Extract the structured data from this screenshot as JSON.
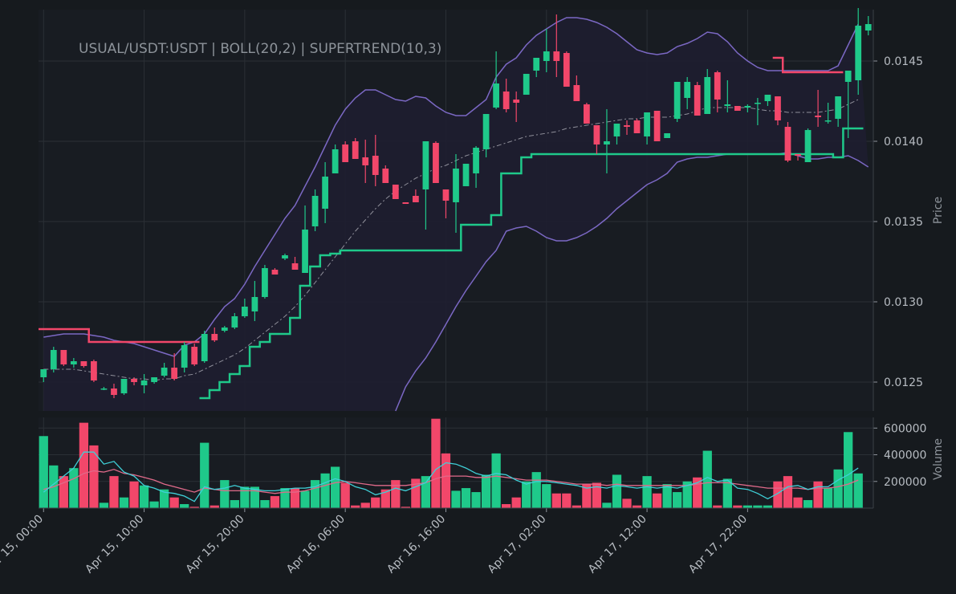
{
  "chart_data": {
    "type": "candlestick",
    "title": "USUAL/USDT:USDT | BOLL(20,2) | SUPERTREND(10,3)",
    "ylabel": "Price",
    "volume_label": "Volume",
    "ylim": [
      0.01232,
      0.01482
    ],
    "y_ticks": [
      0.0125,
      0.013,
      0.0135,
      0.014,
      0.0145
    ],
    "y_tick_labels": [
      "0.0125",
      "0.0130",
      "0.0135",
      "0.0140",
      "0.0145"
    ],
    "volume_ylim": [
      0,
      680000
    ],
    "volume_ticks": [
      200000,
      400000,
      600000
    ],
    "volume_tick_labels": [
      "200000",
      "400000",
      "600000"
    ],
    "x_start": "2025-04-15 00:00",
    "bar_interval_hours": 1,
    "x_tick_labels": [
      "Apr 15, 00:00",
      "Apr 15, 10:00",
      "Apr 15, 20:00",
      "Apr 16, 06:00",
      "Apr 16, 16:00",
      "Apr 17, 02:00",
      "Apr 17, 12:00",
      "Apr 17, 22:00"
    ],
    "x_tick_index": [
      0,
      10,
      20,
      30,
      40,
      50,
      60,
      70
    ],
    "colors": {
      "background": "#161a1e",
      "grid": "#2b3036",
      "up": "#1fc98a",
      "down": "#f2476a",
      "band": "#7b68c4",
      "band_fill": "#1e1e30",
      "mid": "#8f8f9a",
      "vol_ma_fast": "#3fd0d8",
      "vol_ma_slow": "#e06a8a"
    },
    "candles": [
      [
        0.01253,
        0.01258,
        0.0125,
        0.01258
      ],
      [
        0.01258,
        0.01272,
        0.01256,
        0.0127
      ],
      [
        0.0127,
        0.0127,
        0.0126,
        0.01261
      ],
      [
        0.01261,
        0.01265,
        0.01259,
        0.01263
      ],
      [
        0.01263,
        0.01263,
        0.01259,
        0.0126
      ],
      [
        0.01263,
        0.01264,
        0.0125,
        0.01251
      ],
      [
        0.01246,
        0.01247,
        0.01245,
        0.01246
      ],
      [
        0.01246,
        0.01249,
        0.0124,
        0.01242
      ],
      [
        0.01243,
        0.01252,
        0.01242,
        0.01252
      ],
      [
        0.01252,
        0.01253,
        0.01248,
        0.0125
      ],
      [
        0.01248,
        0.01255,
        0.01243,
        0.01251
      ],
      [
        0.0125,
        0.01253,
        0.01249,
        0.01253
      ],
      [
        0.01254,
        0.01262,
        0.01253,
        0.01259
      ],
      [
        0.01259,
        0.01268,
        0.01251,
        0.01252
      ],
      [
        0.01259,
        0.01275,
        0.01256,
        0.01273
      ],
      [
        0.01272,
        0.01274,
        0.0126,
        0.01261
      ],
      [
        0.01263,
        0.01282,
        0.01262,
        0.0128
      ],
      [
        0.0128,
        0.01284,
        0.01275,
        0.01276
      ],
      [
        0.01282,
        0.01285,
        0.01281,
        0.01284
      ],
      [
        0.01284,
        0.01293,
        0.01283,
        0.01291
      ],
      [
        0.01291,
        0.01302,
        0.0129,
        0.01297
      ],
      [
        0.01294,
        0.01313,
        0.01288,
        0.01303
      ],
      [
        0.01303,
        0.01323,
        0.01302,
        0.01321
      ],
      [
        0.0132,
        0.01321,
        0.01317,
        0.01317
      ],
      [
        0.01327,
        0.0133,
        0.01326,
        0.01329
      ],
      [
        0.01324,
        0.01328,
        0.01322,
        0.0132
      ],
      [
        0.01318,
        0.0136,
        0.01318,
        0.01345
      ],
      [
        0.01347,
        0.0137,
        0.01344,
        0.01366
      ],
      [
        0.01358,
        0.01387,
        0.01349,
        0.01378
      ],
      [
        0.0138,
        0.01398,
        0.0138,
        0.01395
      ],
      [
        0.01398,
        0.014,
        0.01387,
        0.01387
      ],
      [
        0.014,
        0.01402,
        0.01402,
        0.01389
      ],
      [
        0.0139,
        0.01401,
        0.01374,
        0.01385
      ],
      [
        0.01391,
        0.01404,
        0.01372,
        0.01379
      ],
      [
        0.01383,
        0.01385,
        0.01383,
        0.01374
      ],
      [
        0.01373,
        0.01373,
        0.0138,
        0.01364
      ],
      [
        0.01362,
        0.01348,
        0.01375,
        0.01361
      ],
      [
        0.01366,
        0.0137,
        0.01362,
        0.01362
      ],
      [
        0.0137,
        0.014,
        0.01345,
        0.014
      ],
      [
        0.01399,
        0.014,
        0.01374,
        0.01374
      ],
      [
        0.0137,
        0.0137,
        0.01352,
        0.01363
      ],
      [
        0.01362,
        0.01392,
        0.01343,
        0.01383
      ],
      [
        0.01372,
        0.01386,
        0.01373,
        0.01386
      ],
      [
        0.0138,
        0.01397,
        0.01371,
        0.01396
      ],
      [
        0.01395,
        0.01417,
        0.0139,
        0.01417
      ],
      [
        0.01421,
        0.01456,
        0.0142,
        0.01436
      ],
      [
        0.01431,
        0.01439,
        0.01418,
        0.0142
      ],
      [
        0.01426,
        0.01431,
        0.01412,
        0.01424
      ],
      [
        0.01429,
        0.01442,
        0.01429,
        0.01442
      ],
      [
        0.01444,
        0.01452,
        0.0144,
        0.01452
      ],
      [
        0.0145,
        0.0147,
        0.01443,
        0.01456
      ],
      [
        0.01456,
        0.01479,
        0.0144,
        0.0145
      ],
      [
        0.01455,
        0.01456,
        0.01434,
        0.01434
      ],
      [
        0.01435,
        0.01441,
        0.01425,
        0.01425
      ],
      [
        0.01423,
        0.01424,
        0.01411,
        0.01411
      ],
      [
        0.0141,
        0.01403,
        0.01392,
        0.01398
      ],
      [
        0.01398,
        0.0142,
        0.0138,
        0.014
      ],
      [
        0.01403,
        0.01411,
        0.01398,
        0.01411
      ],
      [
        0.0141,
        0.01413,
        0.01404,
        0.01409
      ],
      [
        0.01413,
        0.01414,
        0.01406,
        0.01405
      ],
      [
        0.01403,
        0.01418,
        0.01398,
        0.01418
      ],
      [
        0.01419,
        0.01419,
        0.014,
        0.014
      ],
      [
        0.01402,
        0.01403,
        0.01402,
        0.01405
      ],
      [
        0.01414,
        0.01435,
        0.01412,
        0.01437
      ],
      [
        0.01427,
        0.0144,
        0.0142,
        0.01437
      ],
      [
        0.01435,
        0.01437,
        0.01416,
        0.01416
      ],
      [
        0.01417,
        0.01445,
        0.01419,
        0.0144
      ],
      [
        0.01443,
        0.01444,
        0.01418,
        0.01426
      ],
      [
        0.01422,
        0.01438,
        0.01418,
        0.01423
      ],
      [
        0.01422,
        0.01421,
        0.0142,
        0.01419
      ],
      [
        0.01421,
        0.01423,
        0.01418,
        0.01422
      ],
      [
        0.01424,
        0.01427,
        0.0141,
        0.01424
      ],
      [
        0.01425,
        0.01425,
        0.01422,
        0.01429
      ],
      [
        0.01428,
        0.01428,
        0.0141,
        0.01413
      ],
      [
        0.01409,
        0.01412,
        0.01387,
        0.01388
      ],
      [
        0.01392,
        0.01392,
        0.01388,
        0.01391
      ],
      [
        0.01387,
        0.01408,
        0.01391,
        0.01407
      ],
      [
        0.01416,
        0.01432,
        0.01409,
        0.01415
      ],
      [
        0.01413,
        0.01424,
        0.01411,
        0.01413
      ],
      [
        0.01414,
        0.01417,
        0.01409,
        0.01428
      ],
      [
        0.01437,
        0.01443,
        0.01402,
        0.01444
      ],
      [
        0.01438,
        0.01483,
        0.01429,
        0.01472
      ],
      [
        0.01469,
        0.01478,
        0.01466,
        0.01473
      ]
    ],
    "volume": [
      540000,
      320000,
      240000,
      300000,
      640000,
      470000,
      40000,
      240000,
      80000,
      200000,
      170000,
      50000,
      140000,
      80000,
      30000,
      10000,
      490000,
      20000,
      210000,
      60000,
      160000,
      160000,
      60000,
      90000,
      150000,
      150000,
      130000,
      210000,
      260000,
      310000,
      190000,
      20000,
      40000,
      80000,
      140000,
      210000,
      10000,
      220000,
      240000,
      670000,
      410000,
      130000,
      150000,
      120000,
      250000,
      410000,
      30000,
      80000,
      200000,
      270000,
      180000,
      110000,
      110000,
      20000,
      180000,
      190000,
      40000,
      250000,
      70000,
      20000,
      240000,
      110000,
      180000,
      120000,
      200000,
      230000,
      430000,
      20000,
      220000,
      20000,
      20000,
      20000,
      20000,
      200000,
      240000,
      80000,
      60000,
      200000,
      150000,
      290000,
      570000,
      260000
    ],
    "bb_upper": [
      0.01278,
      0.01279,
      0.0128,
      0.0128,
      0.0128,
      0.01279,
      0.01278,
      0.01276,
      0.01275,
      0.01274,
      0.01272,
      0.0127,
      0.01268,
      0.01266,
      0.01273,
      0.01275,
      0.0128,
      0.01289,
      0.01297,
      0.01302,
      0.01311,
      0.01322,
      0.01332,
      0.01342,
      0.01352,
      0.0136,
      0.01372,
      0.01384,
      0.01397,
      0.0141,
      0.0142,
      0.01427,
      0.01432,
      0.01432,
      0.01429,
      0.01426,
      0.01425,
      0.01428,
      0.01427,
      0.01422,
      0.01418,
      0.01416,
      0.01416,
      0.01421,
      0.01426,
      0.0144,
      0.01448,
      0.01452,
      0.0146,
      0.01466,
      0.0147,
      0.01474,
      0.01477,
      0.01477,
      0.01476,
      0.01474,
      0.01471,
      0.01467,
      0.01462,
      0.01457,
      0.01455,
      0.01454,
      0.01455,
      0.01459,
      0.01461,
      0.01464,
      0.01468,
      0.01467,
      0.01462,
      0.01455,
      0.0145,
      0.01446,
      0.01444,
      0.01444,
      0.01444,
      0.01444,
      0.01444,
      0.01444,
      0.01444,
      0.01447,
      0.0146,
      0.01473
    ],
    "bb_mid": [
      0.01258,
      0.01258,
      0.01258,
      0.01258,
      0.01257,
      0.01256,
      0.01255,
      0.01254,
      0.01253,
      0.01252,
      0.01252,
      0.01251,
      0.01252,
      0.01252,
      0.01254,
      0.01255,
      0.01258,
      0.01261,
      0.01264,
      0.01267,
      0.01271,
      0.01276,
      0.01281,
      0.01286,
      0.01291,
      0.01297,
      0.01304,
      0.01312,
      0.0132,
      0.01328,
      0.01336,
      0.01344,
      0.01351,
      0.01358,
      0.01364,
      0.01369,
      0.01373,
      0.01377,
      0.0138,
      0.01383,
      0.01385,
      0.01388,
      0.01391,
      0.01393,
      0.01395,
      0.01397,
      0.01399,
      0.01401,
      0.01403,
      0.01404,
      0.01405,
      0.01406,
      0.01408,
      0.01409,
      0.0141,
      0.01411,
      0.01412,
      0.01413,
      0.01414,
      0.01414,
      0.01415,
      0.01415,
      0.01415,
      0.01416,
      0.01417,
      0.01419,
      0.01421,
      0.01421,
      0.01421,
      0.01421,
      0.01421,
      0.0142,
      0.01419,
      0.01419,
      0.01418,
      0.01418,
      0.01418,
      0.01418,
      0.01419,
      0.0142,
      0.01423,
      0.01426
    ],
    "bb_lower": [
      null,
      null,
      null,
      null,
      null,
      null,
      null,
      null,
      null,
      null,
      null,
      null,
      null,
      null,
      null,
      null,
      null,
      null,
      null,
      null,
      null,
      null,
      null,
      null,
      null,
      null,
      null,
      null,
      null,
      null,
      null,
      null,
      null,
      null,
      null,
      0.01232,
      0.01247,
      0.01257,
      0.01265,
      0.01275,
      0.01286,
      0.01297,
      0.01307,
      0.01316,
      0.01325,
      0.01332,
      0.01344,
      0.01346,
      0.01347,
      0.01344,
      0.0134,
      0.01338,
      0.01338,
      0.0134,
      0.01343,
      0.01347,
      0.01352,
      0.01358,
      0.01363,
      0.01368,
      0.01373,
      0.01376,
      0.0138,
      0.01387,
      0.01389,
      0.0139,
      0.0139,
      0.01391,
      0.01392,
      0.01392,
      0.01392,
      0.01392,
      0.01392,
      0.01392,
      0.01393,
      0.01391,
      0.01389,
      0.01389,
      0.0139,
      0.0139,
      0.01391,
      0.01388,
      0.01384
    ],
    "supertrend_up": [
      null,
      null,
      null,
      null,
      null,
      null,
      null,
      null,
      null,
      null,
      null,
      null,
      null,
      null,
      null,
      null,
      0.0124,
      0.01245,
      0.0125,
      0.01255,
      0.0126,
      0.01272,
      0.01275,
      0.0128,
      0.0128,
      0.0129,
      0.0131,
      0.01322,
      0.01329,
      0.0133,
      0.01332,
      0.01332,
      0.01332,
      0.01332,
      0.01332,
      0.01332,
      0.01332,
      0.01332,
      0.01332,
      0.01332,
      0.01332,
      0.01332,
      0.01348,
      0.01348,
      0.01348,
      0.01354,
      0.0138,
      0.0138,
      0.0139,
      0.01392,
      0.01392,
      0.01392,
      0.01392,
      0.01392,
      0.01392,
      0.01392,
      0.01392,
      0.01392,
      0.01392,
      0.01392,
      0.01392,
      0.01392,
      0.01392,
      0.01392,
      0.01392,
      0.01392,
      0.01392,
      0.01392,
      0.01392,
      0.01392,
      0.01392,
      0.01392,
      0.01392,
      0.01392,
      0.01392,
      0.01392,
      0.01392,
      0.01392,
      0.01392,
      0.0139,
      0.01408,
      0.01408
    ],
    "supertrend_down": [
      0.01283,
      0.01283,
      0.01283,
      0.01283,
      0.01283,
      0.01275,
      0.01275,
      0.01275,
      0.01275,
      0.01275,
      0.01275,
      0.01275,
      0.01275,
      0.01275,
      0.01275,
      0.01275,
      null,
      null,
      null,
      null,
      null,
      null,
      null,
      null,
      null,
      null,
      null,
      null,
      null,
      null,
      null,
      null,
      null,
      null,
      null,
      null,
      null,
      null,
      null,
      null,
      null,
      null,
      null,
      null,
      null,
      null,
      null,
      null,
      null,
      null,
      null,
      null,
      null,
      null,
      null,
      null,
      null,
      null,
      null,
      null,
      null,
      null,
      null,
      null,
      null,
      null,
      null,
      null,
      null,
      null,
      null,
      null,
      null,
      0.01452,
      0.01443,
      0.01443,
      0.01443,
      0.01443,
      0.01443,
      0.01443,
      null,
      null
    ],
    "vol_ma_fast": [
      120000,
      180000,
      240000,
      300000,
      420000,
      420000,
      330000,
      350000,
      270000,
      240000,
      170000,
      150000,
      120000,
      110000,
      90000,
      50000,
      160000,
      140000,
      150000,
      170000,
      150000,
      140000,
      130000,
      130000,
      140000,
      150000,
      150000,
      160000,
      190000,
      220000,
      200000,
      160000,
      140000,
      100000,
      120000,
      150000,
      130000,
      160000,
      190000,
      290000,
      340000,
      330000,
      300000,
      260000,
      240000,
      260000,
      250000,
      210000,
      180000,
      200000,
      200000,
      190000,
      180000,
      170000,
      150000,
      160000,
      150000,
      170000,
      160000,
      150000,
      160000,
      150000,
      160000,
      150000,
      170000,
      190000,
      230000,
      200000,
      210000,
      150000,
      140000,
      110000,
      70000,
      110000,
      160000,
      170000,
      140000,
      160000,
      160000,
      210000,
      250000,
      300000
    ],
    "vol_ma_slow": [
      140000,
      160000,
      190000,
      220000,
      260000,
      280000,
      270000,
      290000,
      260000,
      250000,
      230000,
      210000,
      180000,
      160000,
      140000,
      120000,
      150000,
      140000,
      130000,
      130000,
      130000,
      130000,
      120000,
      110000,
      120000,
      120000,
      130000,
      150000,
      170000,
      190000,
      200000,
      190000,
      180000,
      170000,
      170000,
      170000,
      170000,
      180000,
      190000,
      220000,
      240000,
      240000,
      240000,
      230000,
      230000,
      240000,
      230000,
      220000,
      210000,
      210000,
      210000,
      200000,
      190000,
      180000,
      180000,
      180000,
      170000,
      180000,
      170000,
      170000,
      170000,
      170000,
      170000,
      170000,
      170000,
      180000,
      190000,
      190000,
      190000,
      180000,
      170000,
      160000,
      150000,
      150000,
      150000,
      150000,
      140000,
      150000,
      150000,
      160000,
      180000,
      210000
    ]
  }
}
